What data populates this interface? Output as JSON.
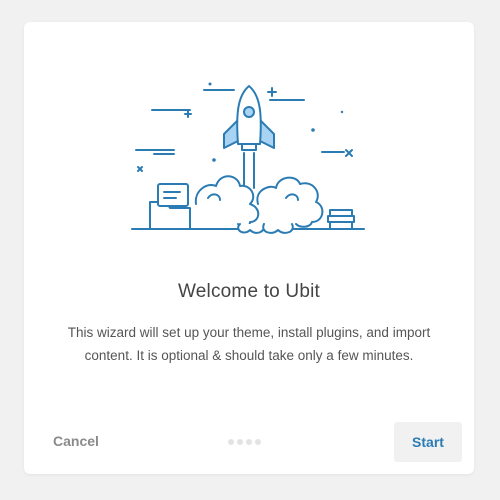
{
  "wizard": {
    "title": "Welcome to Ubit",
    "description": "This wizard will set up your theme, install plugins, and import content. It is optional & should take only a few minutes.",
    "cancel_label": "Cancel",
    "start_label": "Start",
    "steps_total": 4,
    "current_step": 1
  },
  "illustration": {
    "icon": "rocket-launch-illustration"
  },
  "colors": {
    "accent": "#2b7cb4",
    "rocket_fill": "#a9d3f2",
    "background": "#f1f1f1"
  }
}
